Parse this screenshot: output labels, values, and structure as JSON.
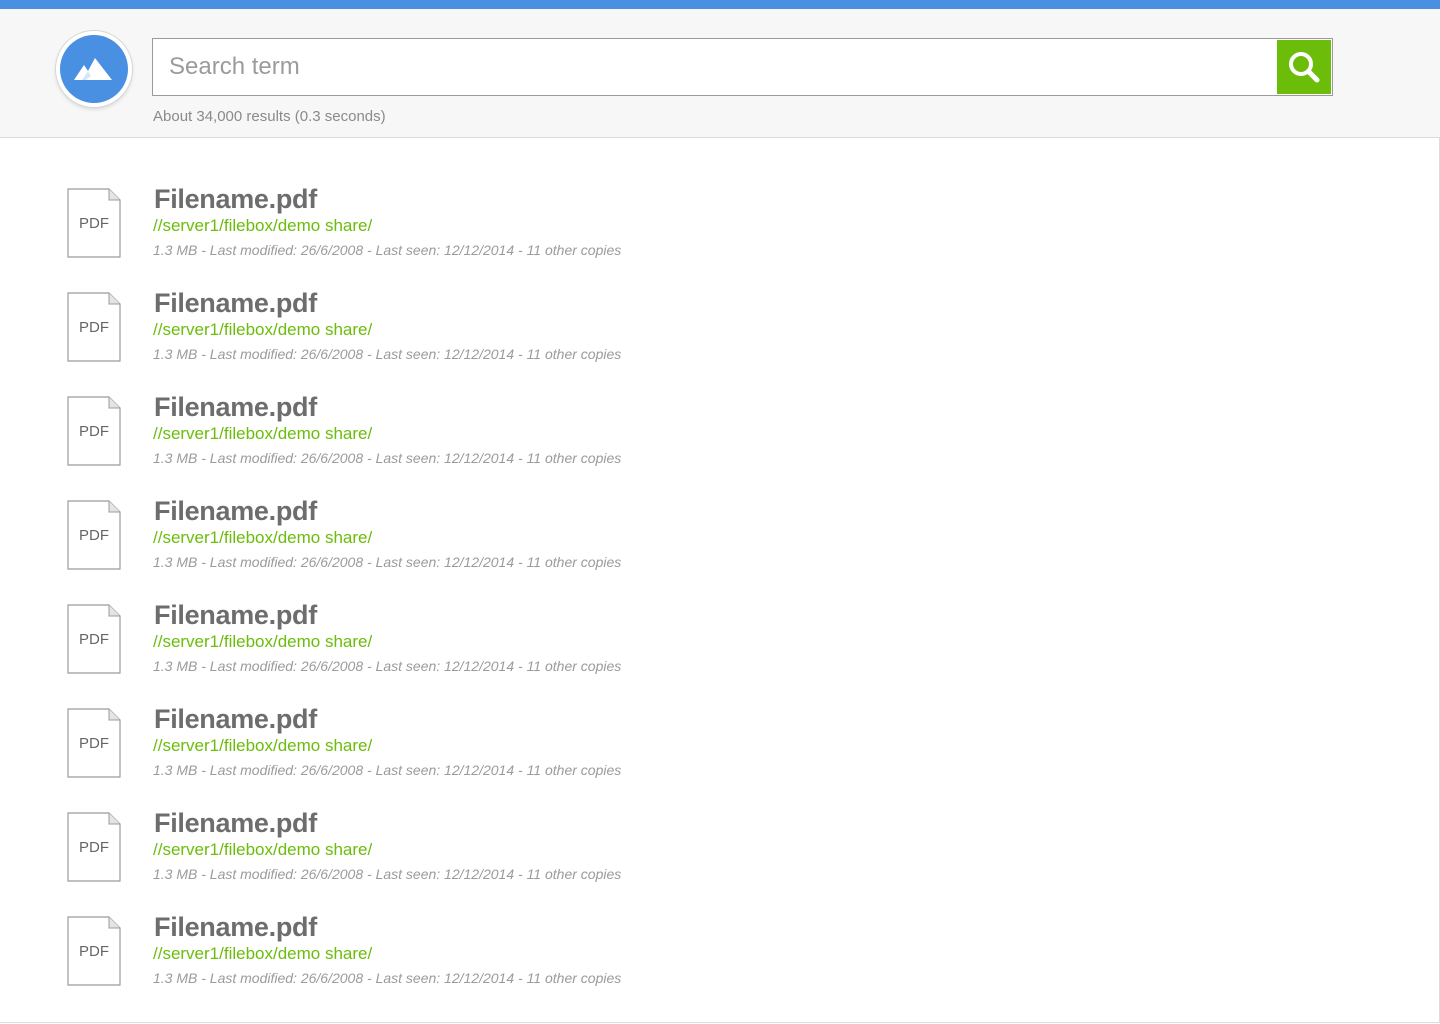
{
  "colors": {
    "accent": "#4a90e2",
    "search_button": "#6bbd0a",
    "path_text": "#6bbd0a",
    "title_text": "#6d6d6d",
    "meta_text": "#9b9b9b"
  },
  "header": {
    "logo_icon": "mountain-icon",
    "search": {
      "placeholder": "Search term",
      "value": "",
      "button_icon": "search-icon"
    },
    "results_summary": "About 34,000 results (0.3 seconds)"
  },
  "results": [
    {
      "icon_label": "PDF",
      "title": "Filename.pdf",
      "path": "//server1/filebox/demo share/",
      "meta": "1.3 MB - Last modified: 26/6/2008 - Last seen: 12/12/2014 - 11 other copies"
    },
    {
      "icon_label": "PDF",
      "title": "Filename.pdf",
      "path": "//server1/filebox/demo share/",
      "meta": "1.3 MB - Last modified: 26/6/2008 - Last seen: 12/12/2014 - 11 other copies"
    },
    {
      "icon_label": "PDF",
      "title": "Filename.pdf",
      "path": "//server1/filebox/demo share/",
      "meta": "1.3 MB - Last modified: 26/6/2008 - Last seen: 12/12/2014 - 11 other copies"
    },
    {
      "icon_label": "PDF",
      "title": "Filename.pdf",
      "path": "//server1/filebox/demo share/",
      "meta": "1.3 MB - Last modified: 26/6/2008 - Last seen: 12/12/2014 - 11 other copies"
    },
    {
      "icon_label": "PDF",
      "title": "Filename.pdf",
      "path": "//server1/filebox/demo share/",
      "meta": "1.3 MB - Last modified: 26/6/2008 - Last seen: 12/12/2014 - 11 other copies"
    },
    {
      "icon_label": "PDF",
      "title": "Filename.pdf",
      "path": "//server1/filebox/demo share/",
      "meta": "1.3 MB - Last modified: 26/6/2008 - Last seen: 12/12/2014 - 11 other copies"
    },
    {
      "icon_label": "PDF",
      "title": "Filename.pdf",
      "path": "//server1/filebox/demo share/",
      "meta": "1.3 MB - Last modified: 26/6/2008 - Last seen: 12/12/2014 - 11 other copies"
    },
    {
      "icon_label": "PDF",
      "title": "Filename.pdf",
      "path": "//server1/filebox/demo share/",
      "meta": "1.3 MB - Last modified: 26/6/2008 - Last seen: 12/12/2014 - 11 other copies"
    }
  ]
}
